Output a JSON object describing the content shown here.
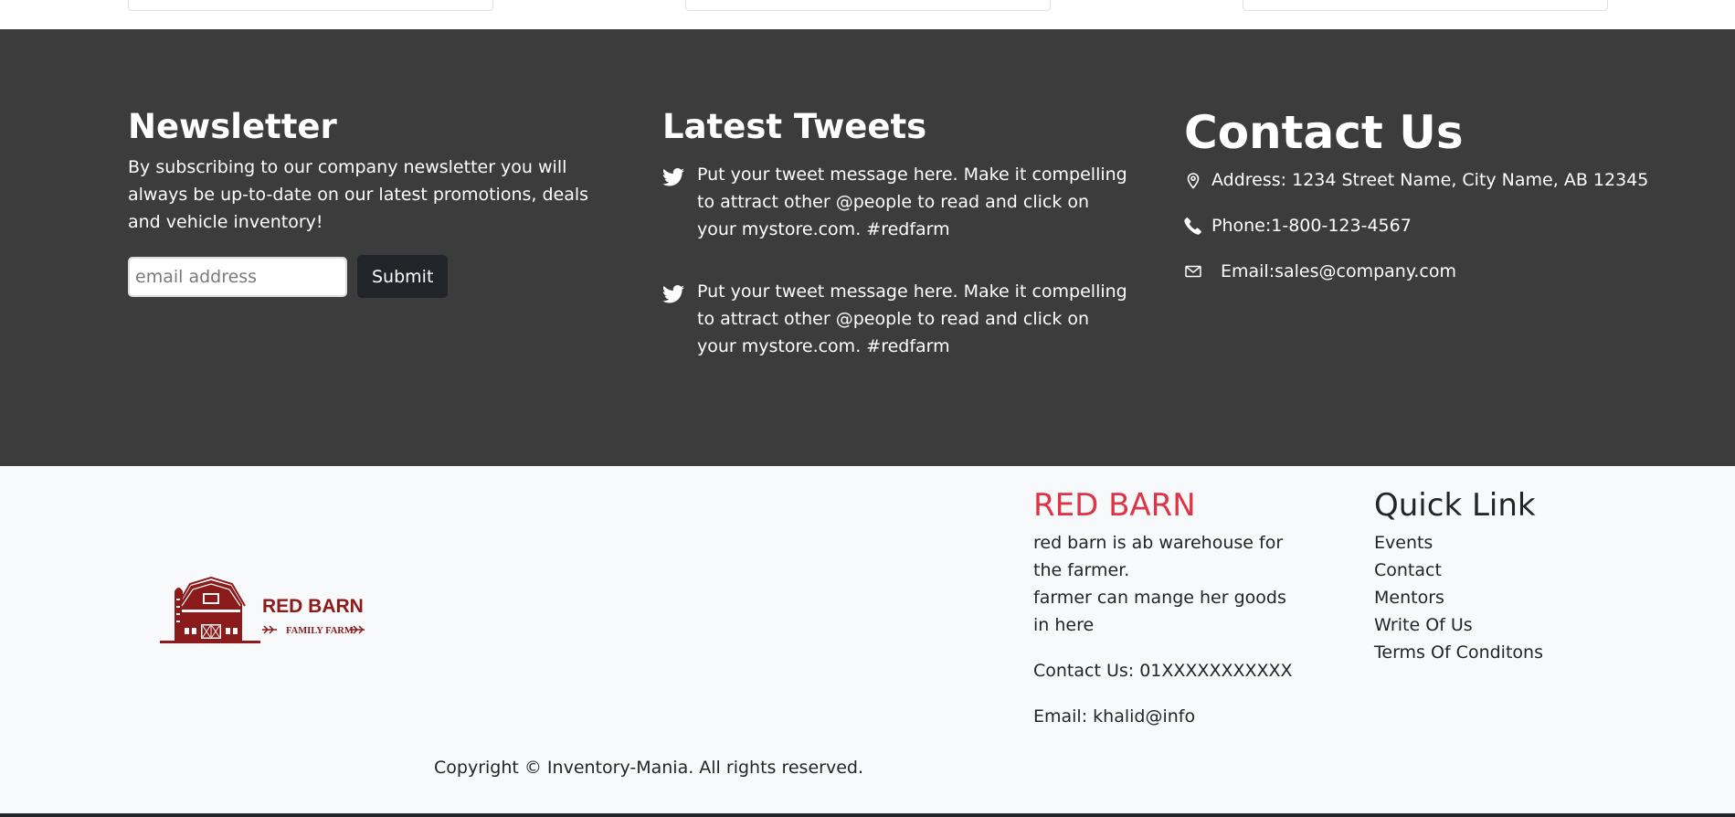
{
  "newsletter": {
    "title": "Newsletter",
    "text": "By subscribing to our company newsletter you will always be up-to-date on our latest promotions, deals and vehicle inventory!",
    "input_placeholder": "email address",
    "submit_label": "Submit"
  },
  "tweets": {
    "title": "Latest Tweets",
    "items": [
      {
        "icon": "twitter-icon",
        "text": "Put your tweet message here. Make it compelling to attract other @people to read and click on your mystore.com. #redfarm"
      },
      {
        "icon": "twitter-icon",
        "text": "Put your tweet message here. Make it compelling to attract other @people to read and click on your mystore.com. #redfarm"
      }
    ]
  },
  "contact": {
    "title": "Contact Us",
    "address": "Address: 1234 Street Name, City Name, AB 12345",
    "phone": "Phone:1-800-123-4567",
    "email": "Email:sales@company.com"
  },
  "logo": {
    "title": "RED BARN",
    "subtitle": "FAMILY FARM",
    "color": "#8b1a1a"
  },
  "red_barn": {
    "title": "RED BARN",
    "desc_1": "red barn is ab warehouse for the farmer.",
    "desc_2": "farmer can mange her goods in here",
    "contact": "Contact Us: 01XXXXXXXXXXX",
    "email": "Email: khalid@info",
    "accent": "#dc3545"
  },
  "quick_link": {
    "title": "Quick Link",
    "items": [
      "Events",
      "Contact",
      "Mentors",
      "Write Of Us",
      "Terms Of Conditons"
    ]
  },
  "footer": {
    "copyright": "Copyright © Inventory-Mania. All rights reserved."
  }
}
